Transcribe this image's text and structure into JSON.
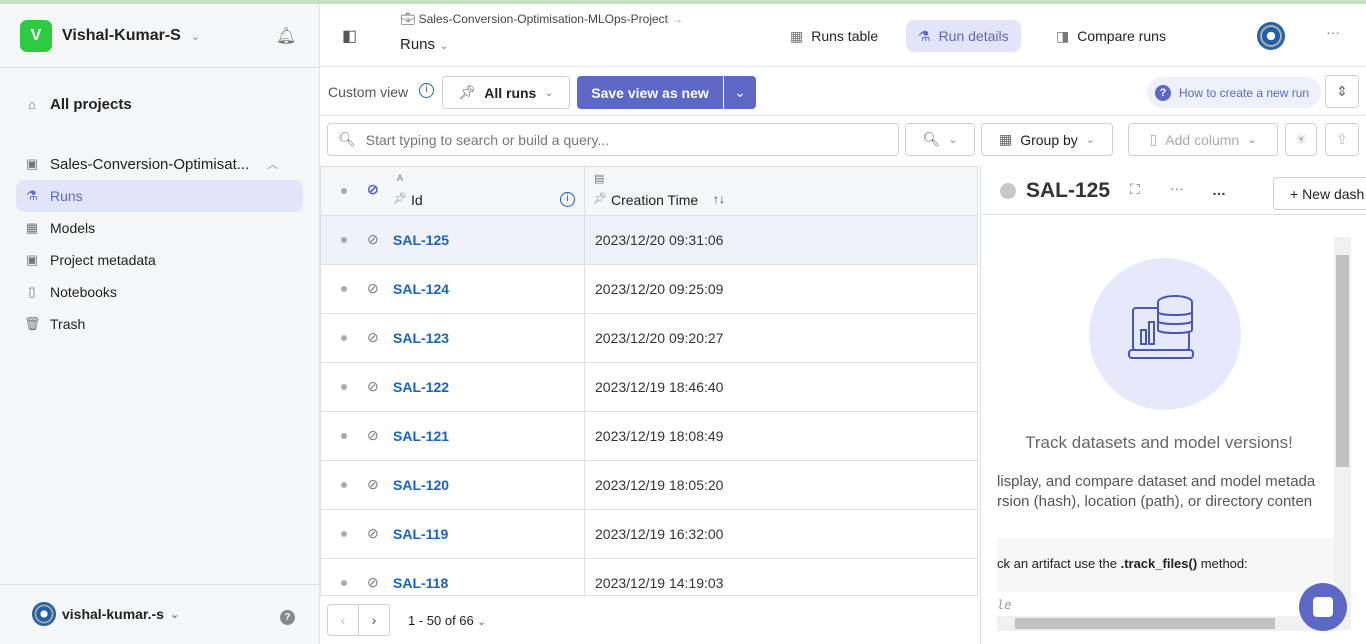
{
  "sidebar": {
    "workspace_initial": "V",
    "workspace": "Vishal-Kumar-S",
    "all_projects": "All projects",
    "project": "Sales-Conversion-Optimisat...",
    "items": [
      {
        "label": "Runs",
        "icon": "flask-icon"
      },
      {
        "label": "Models",
        "icon": "chip-icon"
      },
      {
        "label": "Project metadata",
        "icon": "clipboard-icon"
      },
      {
        "label": "Notebooks",
        "icon": "notebook-icon"
      },
      {
        "label": "Trash",
        "icon": "trash-icon"
      }
    ],
    "account": "vishal-kumar.-s"
  },
  "header": {
    "breadcrumb": "Sales-Conversion-Optimisation-MLOps-Project",
    "section": "Runs",
    "tabs": [
      "Runs table",
      "Run details",
      "Compare runs"
    ],
    "more": "···"
  },
  "toolbar": {
    "custom_view": "Custom view",
    "view": "All runs",
    "save": "Save view as new",
    "howto": "How to create a new run"
  },
  "search": {
    "placeholder": "Start typing to search or build a query...",
    "group_by": "Group by",
    "add_column": "Add column"
  },
  "table": {
    "columns": [
      "Id",
      "Creation Time"
    ],
    "col_type": "A",
    "rows": [
      {
        "id": "SAL-125",
        "time": "2023/12/20 09:31:06"
      },
      {
        "id": "SAL-124",
        "time": "2023/12/20 09:25:09"
      },
      {
        "id": "SAL-123",
        "time": "2023/12/20 09:20:27"
      },
      {
        "id": "SAL-122",
        "time": "2023/12/19 18:46:40"
      },
      {
        "id": "SAL-121",
        "time": "2023/12/19 18:08:49"
      },
      {
        "id": "SAL-120",
        "time": "2023/12/19 18:05:20"
      },
      {
        "id": "SAL-119",
        "time": "2023/12/19 16:32:00"
      },
      {
        "id": "SAL-118",
        "time": "2023/12/19 14:19:03"
      }
    ]
  },
  "pagination": {
    "range": "1 - 50 of 66"
  },
  "panel": {
    "run": "SAL-125",
    "new_dash": "+ New dash",
    "title": "Track datasets and model versions!",
    "line1": "lisplay, and compare dataset and model metada",
    "line2": "rsion (hash), location (path), or directory conten",
    "code_hint_pre": "ck an artifact use the ",
    "code_hint_fn": ".track_files()",
    "code_hint_post": " method:",
    "code": "le"
  },
  "colors": {
    "accent": "#5c68c4",
    "link": "#1a63b8",
    "brand_green": "#2dcc40"
  }
}
